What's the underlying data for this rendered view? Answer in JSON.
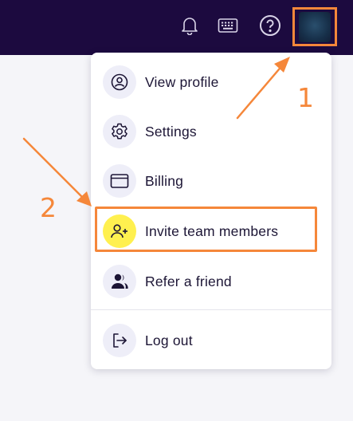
{
  "topbar": {
    "icons": [
      "bell-icon",
      "keyboard-icon",
      "help-icon"
    ],
    "background": "#1c0a3f"
  },
  "menu": {
    "items": [
      {
        "label": "View profile",
        "icon": "user-circle-icon"
      },
      {
        "label": "Settings",
        "icon": "gear-icon"
      },
      {
        "label": "Billing",
        "icon": "card-icon"
      },
      {
        "label": "Invite team members",
        "icon": "user-plus-icon",
        "highlighted": true
      },
      {
        "label": "Refer a friend",
        "icon": "users-icon"
      },
      {
        "label": "Log out",
        "icon": "logout-icon"
      }
    ]
  },
  "annotations": {
    "step1": "1",
    "step2": "2",
    "color": "#f5873a"
  },
  "colors": {
    "highlight_circle": "#fff04f",
    "icon_circle": "#eeeef8"
  }
}
